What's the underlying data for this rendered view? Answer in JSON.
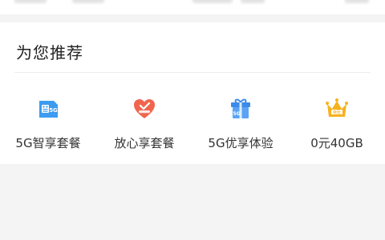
{
  "section": {
    "title": "为您推荐"
  },
  "items": [
    {
      "label": "5G智享套餐",
      "icon": "5g-sim-card-icon",
      "color": "#3d9bf0"
    },
    {
      "label": "放心享套餐",
      "icon": "heart-badge-icon",
      "color": "#f0654e"
    },
    {
      "label": "5G优享体验",
      "icon": "gift-box-icon",
      "color": "#3c8be8"
    },
    {
      "label": "0元40GB",
      "icon": "crown-icon",
      "color": "#f6b21c"
    }
  ],
  "colors": {
    "background": "#f4f4f4",
    "card": "#ffffff",
    "text": "#333333"
  }
}
